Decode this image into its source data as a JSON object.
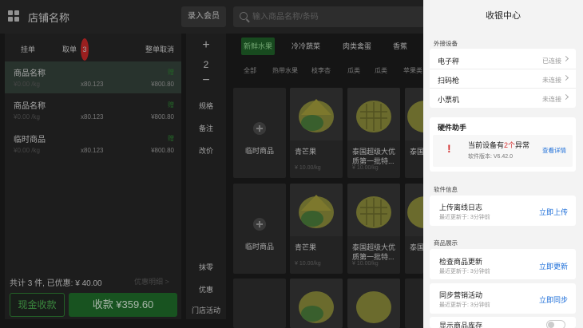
{
  "store": {
    "name": "店铺名称"
  },
  "header": {
    "member_btn": "录入会员",
    "search_placeholder": "输入商品名称/条码"
  },
  "order": {
    "actions": [
      "挂单",
      "取单",
      "整单取消"
    ],
    "badge": "3",
    "items": [
      {
        "name": "商品名称",
        "status": "赠",
        "unit_price": "¥0.00 /kg",
        "qty": "x80.123",
        "total": "¥800.80"
      },
      {
        "name": "商品名称",
        "status": "赠",
        "unit_price": "¥0.00 /kg",
        "qty": "x80.123",
        "total": "¥800.80"
      },
      {
        "name": "临时商品",
        "status": "赠",
        "unit_price": "¥0.00 /kg",
        "qty": "x80.123",
        "total": "¥800.80"
      }
    ],
    "summary": "共计 3 件, 已优惠: ¥ 40.00",
    "pending_text": "优惠明细 >",
    "cash_btn": "现金收款",
    "pay_btn": "收款 ¥359.60"
  },
  "tools": {
    "plus": "+",
    "qty": "2",
    "minus": "−",
    "items": [
      "规格",
      "备注",
      "改价"
    ],
    "bottom": [
      "抹零",
      "优惠",
      "门店活动"
    ]
  },
  "categories": {
    "main": [
      "新鲜水果",
      "冷冷蔬菜",
      "肉类禽蛋",
      "香蕉"
    ],
    "sub": [
      "全部",
      "热带水果",
      "枝李杏",
      "瓜类",
      "瓜类",
      "苹果类"
    ]
  },
  "products": {
    "temp_label": "临时商品",
    "mango_name": "青芒果",
    "thai_name": "泰国超级大优质第一批特...",
    "thai_cut": "泰国",
    "price": "¥ 10.00/kg"
  },
  "drawer": {
    "title": "收银中心",
    "devices": {
      "title": "外接设备",
      "rows": [
        {
          "label": "电子秤",
          "status": "已连接"
        },
        {
          "label": "扫码枪",
          "status": "未连接"
        },
        {
          "label": "小票机",
          "status": "未连接"
        }
      ]
    },
    "hardware": {
      "title": "硬件助手",
      "alert_prefix": "当前设备有",
      "alert_count": "2个",
      "alert_suffix": "异常",
      "version": "软件版本: V6.42.0",
      "detail": "查看详情"
    },
    "software": {
      "title": "软件信息",
      "upload_title": "上传离线日志",
      "upload_time": "最近更新于: 3分钟前",
      "upload_btn": "立即上传"
    },
    "display": {
      "title": "商品展示",
      "check_title": "检查商品更新",
      "check_time": "最近更新于: 3分钟前",
      "check_btn": "立即更新",
      "sync_title": "同步营销活动",
      "sync_time": "最近更新于: 3分钟前",
      "sync_btn": "立即同步",
      "stock_title": "显示商品库存"
    }
  }
}
